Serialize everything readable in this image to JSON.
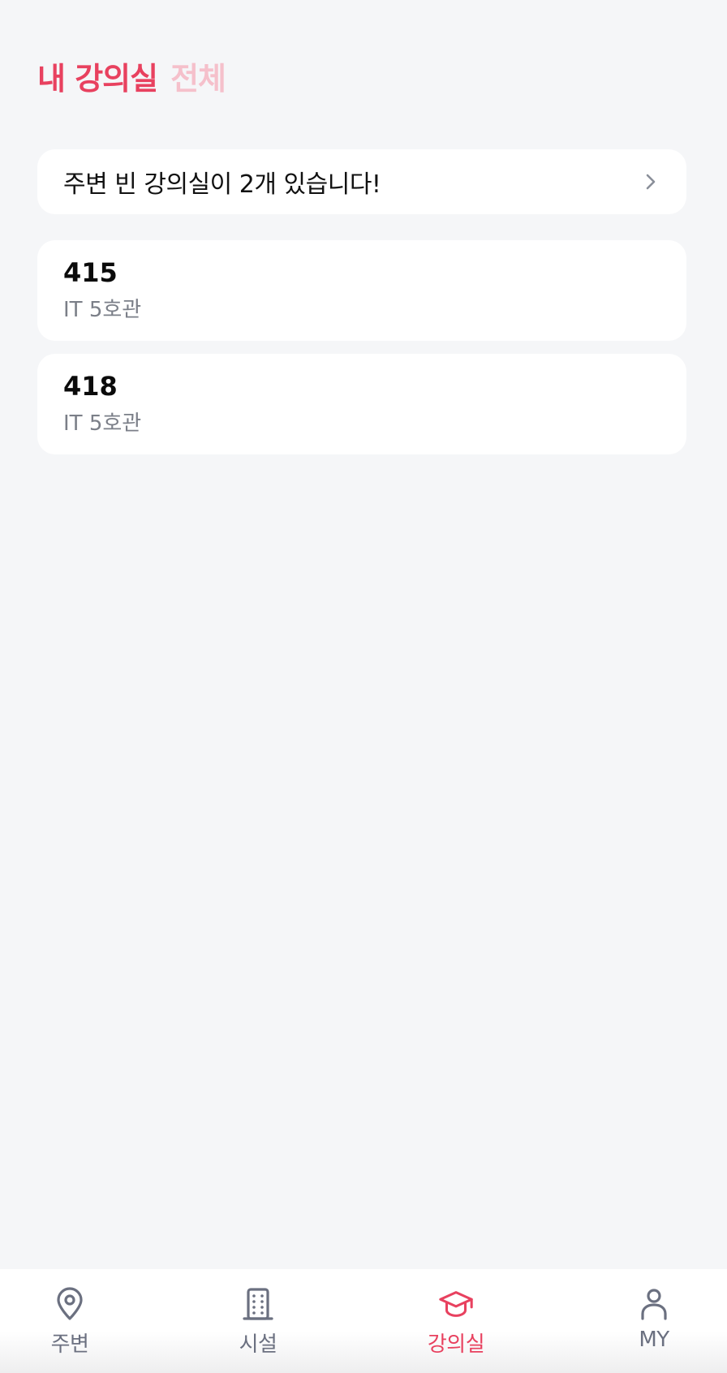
{
  "header": {
    "tabs": [
      {
        "label": "내 강의실",
        "active": true
      },
      {
        "label": "전체",
        "active": false
      }
    ]
  },
  "banner": {
    "text": "주변 빈 강의실이 2개 있습니다!",
    "icon": "chevron-right-icon"
  },
  "rooms": [
    {
      "number": "415",
      "building": "IT 5호관"
    },
    {
      "number": "418",
      "building": "IT 5호관"
    }
  ],
  "bottom_nav": {
    "items": [
      {
        "label": "주변",
        "icon": "map-pin-icon",
        "active": false
      },
      {
        "label": "시설",
        "icon": "building-icon",
        "active": false
      },
      {
        "label": "강의실",
        "icon": "graduation-cap-icon",
        "active": true
      },
      {
        "label": "MY",
        "icon": "user-icon",
        "active": false
      }
    ]
  },
  "colors": {
    "accent": "#e8415f",
    "accent_light": "#f5c0cb",
    "background": "#f5f6f8",
    "card": "#ffffff",
    "muted_text": "#7b7f88",
    "nav_inactive": "#6b7080"
  }
}
